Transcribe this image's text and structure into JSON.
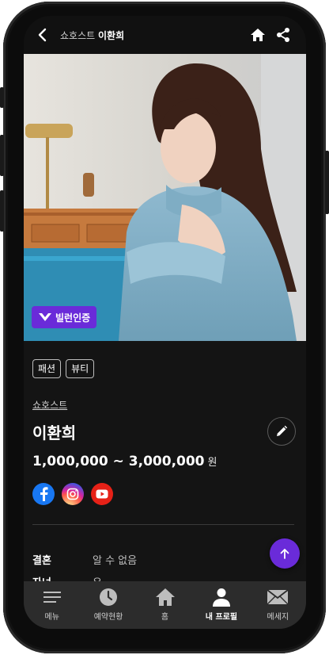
{
  "header": {
    "category": "쇼호스트",
    "name": "이환희"
  },
  "badge": {
    "label": "빌런인증"
  },
  "tags": [
    "패션",
    "뷰티"
  ],
  "profile": {
    "category": "쇼호스트",
    "name": "이환희",
    "price_range": "1,000,000 ~ 3,000,000",
    "price_unit": "원"
  },
  "socials": [
    {
      "icon": "facebook-icon",
      "color": "#1877f2"
    },
    {
      "icon": "instagram-icon",
      "color": "#d6249f"
    },
    {
      "icon": "youtube-icon",
      "color": "#e62117"
    }
  ],
  "info": [
    {
      "label": "결혼",
      "value": "알 수 없음"
    },
    {
      "label": "자녀",
      "value": "유"
    }
  ],
  "nav": [
    {
      "label": "메뉴",
      "icon": "menu-icon"
    },
    {
      "label": "예약현황",
      "icon": "clock-icon"
    },
    {
      "label": "홈",
      "icon": "home-icon"
    },
    {
      "label": "내 프로필",
      "icon": "person-icon",
      "active": true
    },
    {
      "label": "메세지",
      "icon": "mail-icon"
    }
  ],
  "colors": {
    "accent": "#6a2bd9",
    "background": "#141414",
    "nav": "#2c2c2c"
  }
}
